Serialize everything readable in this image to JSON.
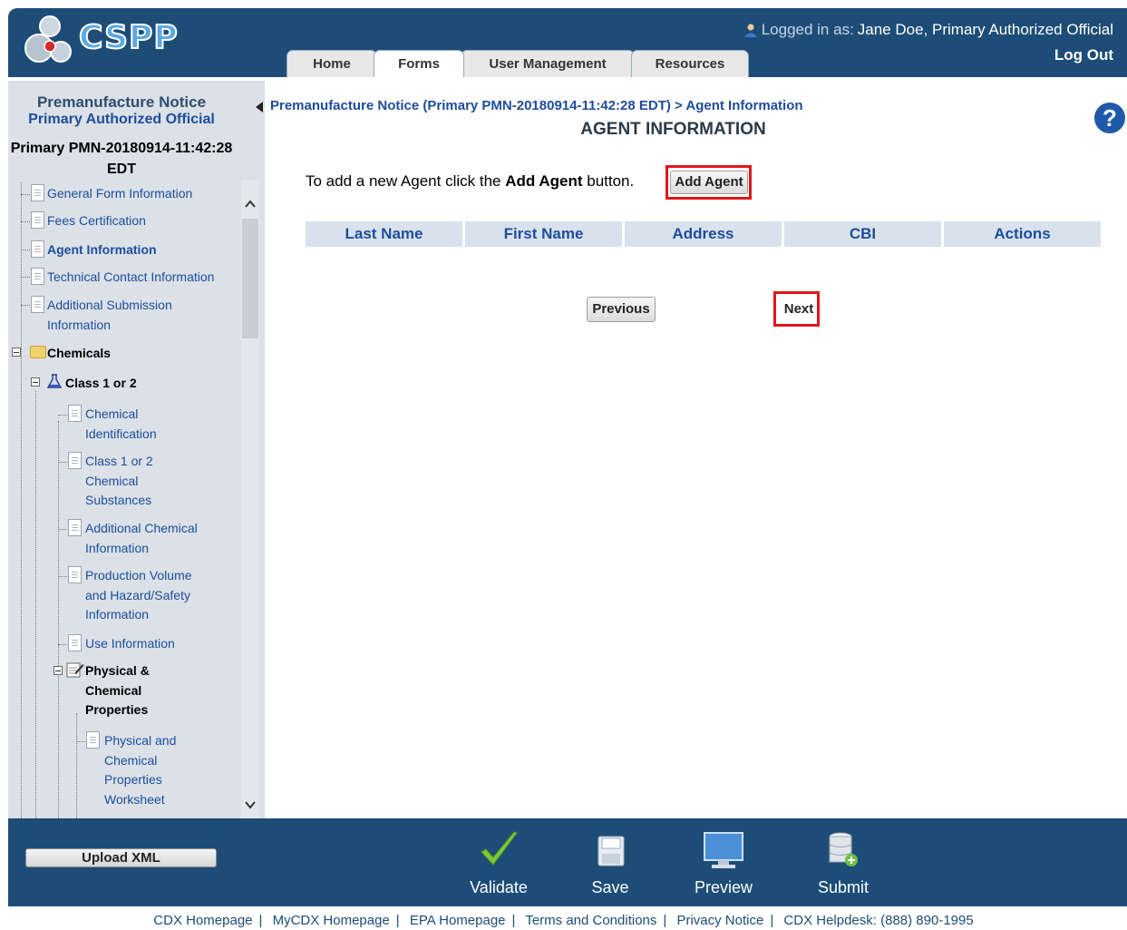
{
  "header": {
    "app_name": "CSPP",
    "logged_in_label": "Logged in as:",
    "user": "Jane Doe, Primary Authorized Official",
    "logout": "Log Out",
    "tabs": [
      "Home",
      "Forms",
      "User Management",
      "Resources"
    ],
    "active_tab": "Forms"
  },
  "sidebar": {
    "title": "Premanufacture Notice",
    "role": "Primary Authorized Official",
    "submission_id": "Primary PMN-20180914-11:42:28 EDT",
    "items": {
      "general": "General Form Information",
      "fees": "Fees Certification",
      "agent": "Agent Information",
      "technical": "Technical Contact Information",
      "additional_submission": "Additional Submission Information",
      "chemicals": "Chemicals",
      "class12": "Class 1 or 2",
      "chem_ident": "Chemical Identification",
      "class12_subs": "Class 1 or 2 Chemical Substances",
      "add_chem": "Additional Chemical Information",
      "production": "Production Volume and Hazard/Safety Information",
      "use": "Use Information",
      "phys_chem": "Physical & Chemical Properties",
      "phys_chem_ws": "Physical and Chemical Properties Worksheet"
    }
  },
  "main": {
    "breadcrumb": "Premanufacture Notice (Primary PMN-20180914-11:42:28 EDT) > Agent Information",
    "title": "AGENT INFORMATION",
    "instruction_pre": "To add a new Agent click the ",
    "instruction_bold": "Add Agent",
    "instruction_post": " button.",
    "add_agent": "Add Agent",
    "columns": [
      "Last Name",
      "First Name",
      "Address",
      "CBI",
      "Actions"
    ],
    "previous": "Previous",
    "next": "Next",
    "help": "?"
  },
  "toolbar": {
    "upload": "Upload XML",
    "validate": "Validate",
    "save": "Save",
    "preview": "Preview",
    "submit": "Submit"
  },
  "footer": {
    "links": [
      "CDX Homepage",
      "MyCDX Homepage",
      "EPA Homepage",
      "Terms and Conditions",
      "Privacy Notice",
      "CDX Helpdesk: (888) 890-1995"
    ]
  },
  "colors": {
    "brand_blue": "#1d4d77",
    "link_blue": "#1d4d9c",
    "highlight_red": "#e0151c",
    "sidebar_bg": "#dbe1e7"
  }
}
